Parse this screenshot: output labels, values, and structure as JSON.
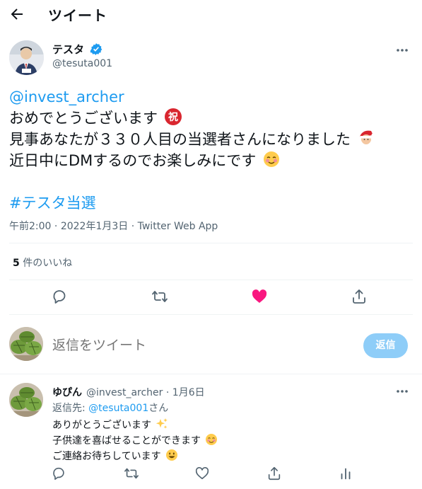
{
  "header": {
    "title": "ツイート",
    "back_icon": "arrow-left-icon"
  },
  "author": {
    "name": "テスタ",
    "handle": "@tesuta001",
    "verified": true
  },
  "tweet": {
    "mention": "@invest_archer",
    "line2": "おめでとうございます",
    "line3": "見事あなたが３３０人目の当選者さんになりました",
    "line4": "近日中にDMするのでお楽しみにです",
    "hashtag": "#テスタ当選",
    "time": "午前2:00",
    "date": "2022年1月3日",
    "source": "Twitter Web App"
  },
  "likes": {
    "count": "5",
    "label": "件のいいね"
  },
  "composer": {
    "placeholder": "返信をツイート",
    "button": "返信"
  },
  "reply": {
    "name": "ゆぴん",
    "handle": "@invest_archer",
    "date": "1月6日",
    "replying_prefix": "返信先: ",
    "replying_to": "@tesuta001",
    "replying_suffix": "さん",
    "line1": "ありがとうございます",
    "line2": "子供達を喜ばせることができます",
    "line3": "ご連絡お待ちしています"
  },
  "colors": {
    "accent": "#1d9bf0",
    "like": "#f91880",
    "muted": "#536471",
    "reply_button": "#8ecdf8"
  }
}
